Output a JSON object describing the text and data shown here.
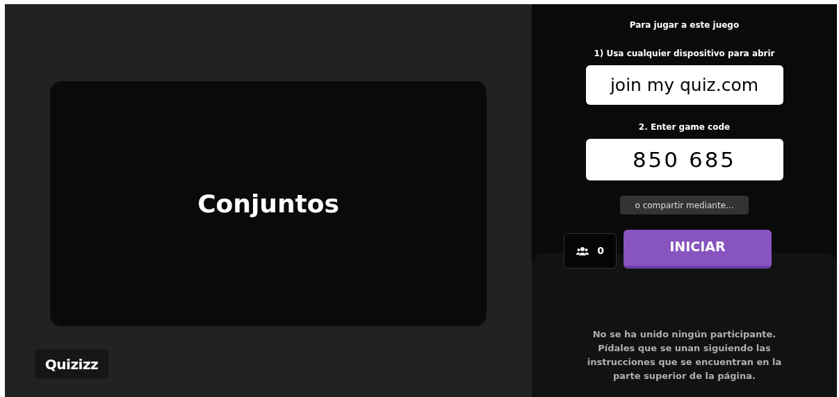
{
  "quiz_card": {
    "title": "Conjuntos"
  },
  "logo": {
    "text": "Quizizz"
  },
  "join": {
    "heading": "Para jugar a este juego",
    "step1": "1) Usa cualquier dispositivo para abrir",
    "url": "join my quiz.com",
    "step2": "2. Enter game code",
    "code": "850 685",
    "share": "o compartir mediante..."
  },
  "players": {
    "count": "0"
  },
  "start_button": {
    "label": "INICIAR"
  },
  "empty_message": "No se ha unido ningún participante. Pídales que se unan siguiendo las instrucciones que se encuentran en la parte superior de la página."
}
